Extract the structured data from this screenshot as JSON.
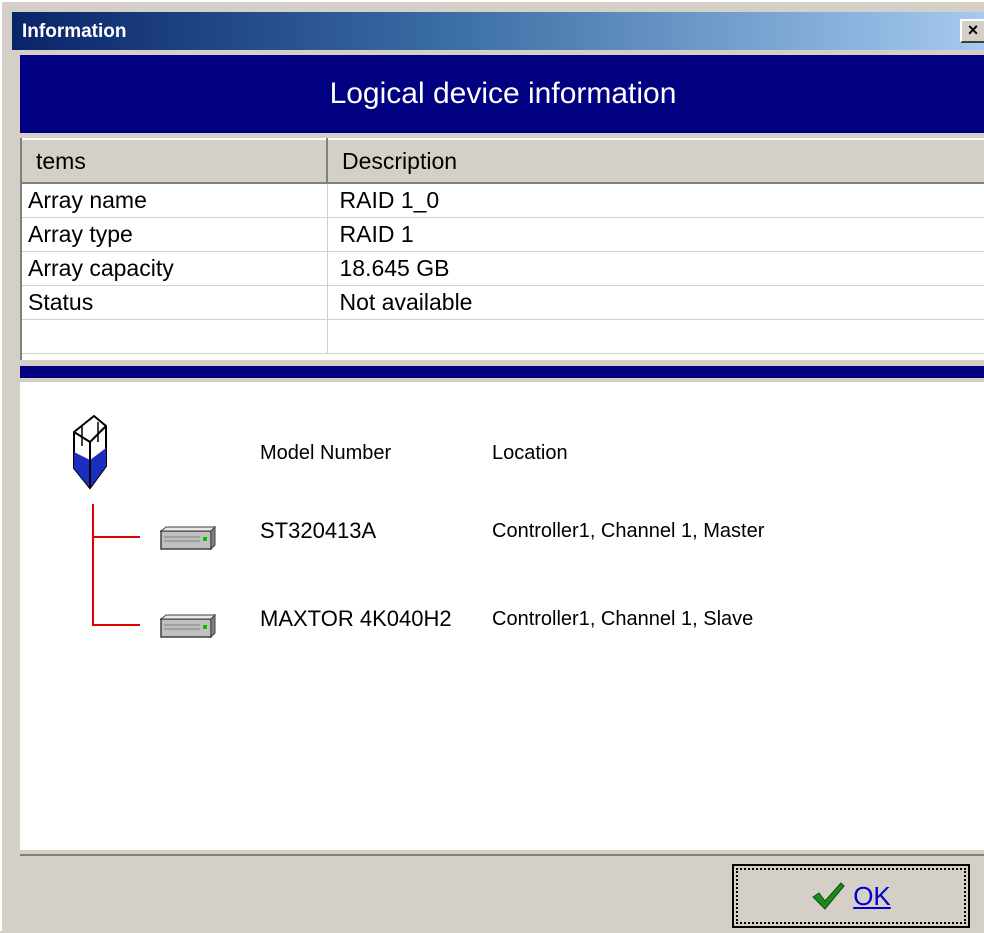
{
  "window": {
    "title": "Information",
    "close_label": "×"
  },
  "header": {
    "title": "Logical device information"
  },
  "table": {
    "columns": [
      "tems",
      "Description"
    ],
    "rows": [
      {
        "item": "Array name",
        "value": "RAID 1_0"
      },
      {
        "item": "Array type",
        "value": "RAID 1"
      },
      {
        "item": "Array capacity",
        "value": "18.645 GB"
      },
      {
        "item": "Status",
        "value": "Not available"
      }
    ]
  },
  "devices": {
    "headers": {
      "model": "Model Number",
      "location": "Location"
    },
    "drives": [
      {
        "model": "ST320413A",
        "location": "Controller1, Channel 1, Master"
      },
      {
        "model": "MAXTOR 4K040H2",
        "location": "Controller1, Channel 1, Slave"
      }
    ]
  },
  "footer": {
    "ok_label": "OK"
  },
  "colors": {
    "banner": "#000080",
    "tree_line": "#e00000",
    "ok_check": "#1e8a1e"
  },
  "icons": {
    "array": "array-icon",
    "drive": "hard-drive-icon",
    "ok": "checkmark-icon",
    "close": "close-icon"
  }
}
